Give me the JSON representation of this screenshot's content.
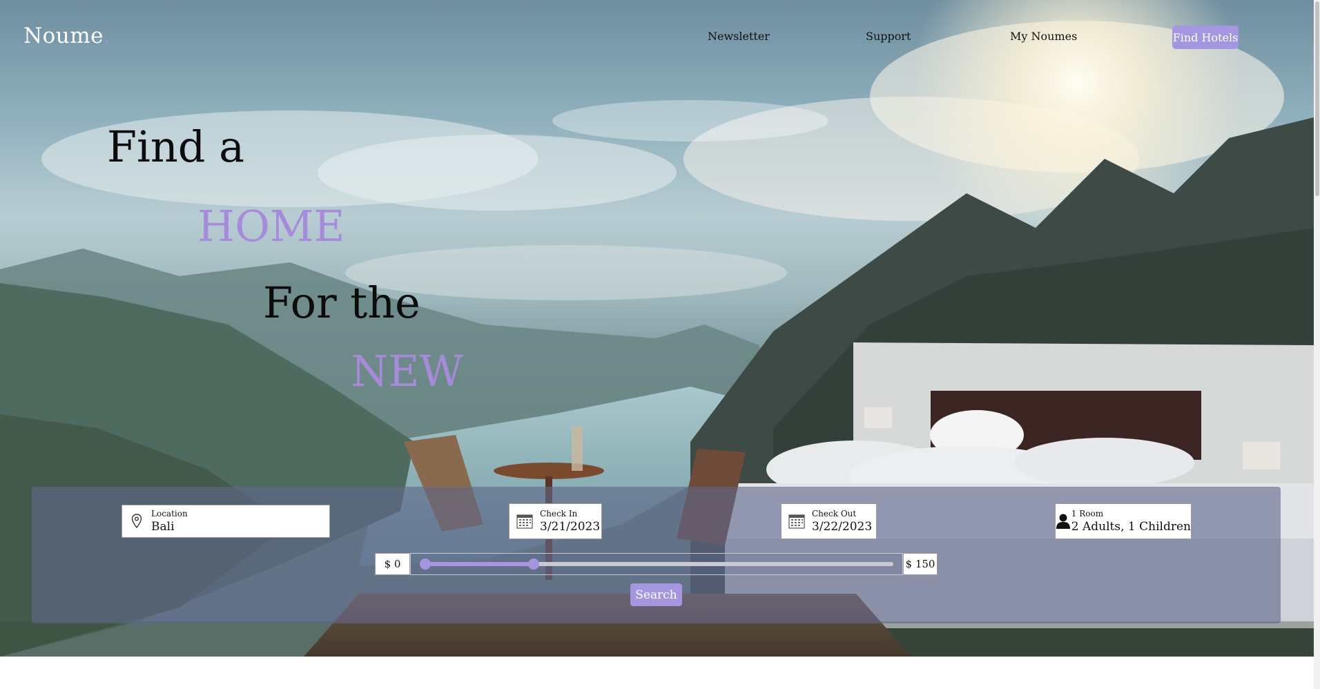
{
  "brand": {
    "name": "Noume",
    "dot": "."
  },
  "nav": {
    "links": [
      "Newsletter",
      "Support",
      "My Noumes"
    ],
    "cta": "Find Hotels"
  },
  "headline": {
    "line1": "Find a",
    "line2": "HOME",
    "line3": "For the",
    "line4": "NEW"
  },
  "search": {
    "location": {
      "label": "Location",
      "value": "Bali",
      "icon": "map-pin-icon"
    },
    "check_in": {
      "label": "Check In",
      "value": "3/21/2023",
      "icon": "calendar-icon"
    },
    "check_out": {
      "label": "Check Out",
      "value": "3/22/2023",
      "icon": "calendar-icon"
    },
    "guests": {
      "label": "1 Room",
      "value": "2 Adults, 1 Children",
      "icon": "person-icon"
    },
    "price": {
      "min_label": "$ 0",
      "max_label": "$ 150",
      "range_low_fraction": 0.0,
      "range_high_fraction": 0.24
    },
    "button": "Search"
  },
  "colors": {
    "accent": "#a78bdb",
    "button": "#a596e0",
    "panel": "#5f688a"
  }
}
